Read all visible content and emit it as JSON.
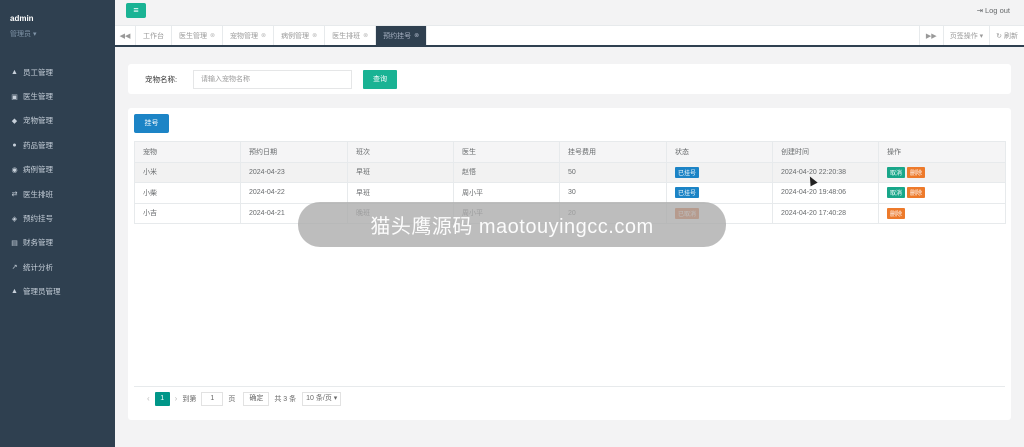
{
  "sidebar": {
    "username": "admin",
    "role": "管理员",
    "role_caret": "▾",
    "items": [
      {
        "label": "员工管理",
        "icon": "user-icon",
        "glyph": "▲"
      },
      {
        "label": "医生管理",
        "icon": "doctor-card-icon",
        "glyph": "▣"
      },
      {
        "label": "宠物管理",
        "icon": "pet-icon",
        "glyph": "◆"
      },
      {
        "label": "药品管理",
        "icon": "medicine-icon",
        "glyph": "●"
      },
      {
        "label": "病例管理",
        "icon": "case-icon",
        "glyph": "◉"
      },
      {
        "label": "医生排班",
        "icon": "schedule-icon",
        "glyph": "⇄"
      },
      {
        "label": "预约挂号",
        "icon": "appointment-icon",
        "glyph": "◈"
      },
      {
        "label": "财务管理",
        "icon": "finance-icon",
        "glyph": "▤"
      },
      {
        "label": "统计分析",
        "icon": "chart-icon",
        "glyph": "↗"
      },
      {
        "label": "管理员管理",
        "icon": "admin-icon",
        "glyph": "▲"
      }
    ]
  },
  "topbar": {
    "menu_glyph": "≡",
    "logout_label": "Log out",
    "logout_glyph": "⇥"
  },
  "tabs": {
    "prev_glyph": "◀◀",
    "next_glyph": "▶▶",
    "close_glyph": "⊗",
    "items": [
      {
        "label": "工作台",
        "closable": false
      },
      {
        "label": "医生管理",
        "closable": true
      },
      {
        "label": "宠物管理",
        "closable": true
      },
      {
        "label": "病例管理",
        "closable": true
      },
      {
        "label": "医生排班",
        "closable": true
      },
      {
        "label": "预约挂号",
        "closable": true,
        "active": true
      }
    ],
    "page_ops_label": "页签操作",
    "page_ops_caret": "▾",
    "refresh_label": "刷新",
    "refresh_glyph": "↻"
  },
  "search": {
    "label": "宠物名称:",
    "placeholder": "请输入宠物名称",
    "button_label": "查询"
  },
  "table": {
    "register_button": "挂号",
    "columns": [
      "宠物",
      "预约日期",
      "班次",
      "医生",
      "挂号费用",
      "状态",
      "创建时间",
      "操作"
    ],
    "rows": [
      {
        "pet": "小米",
        "date": "2024-04-23",
        "shift": "早班",
        "doctor": "赵悟",
        "fee": "50",
        "status": "已挂号",
        "status_color": "#1c84c6",
        "created": "2024-04-20 22:20:38",
        "actions": [
          "取消",
          "删除"
        ]
      },
      {
        "pet": "小柴",
        "date": "2024-04-22",
        "shift": "早班",
        "doctor": "周小平",
        "fee": "30",
        "status": "已挂号",
        "status_color": "#1c84c6",
        "created": "2024-04-20 19:48:06",
        "actions": [
          "取消",
          "删除"
        ]
      },
      {
        "pet": "小吉",
        "date": "2024-04-21",
        "shift": "晚班",
        "doctor": "周小平",
        "fee": "20",
        "status": "已取消",
        "status_color": "#e0662a",
        "created": "2024-04-20 17:40:28",
        "actions": [
          "删除"
        ]
      }
    ]
  },
  "pagination": {
    "prev_glyph": "‹",
    "next_glyph": "›",
    "current_page": "1",
    "goto_label": "到第",
    "goto_value": "1",
    "page_unit": "页",
    "confirm_label": "确定",
    "total_label": "共 3 条",
    "page_size_label": "10 条/页"
  },
  "watermark": {
    "overlay_text": "猫头鹰源码 maotouyingcc.com"
  },
  "colors": {
    "sidebar_bg": "#2f4050",
    "accent_green": "#1ab394",
    "primary_blue": "#1c84c6",
    "warning_orange": "#e0662a"
  }
}
